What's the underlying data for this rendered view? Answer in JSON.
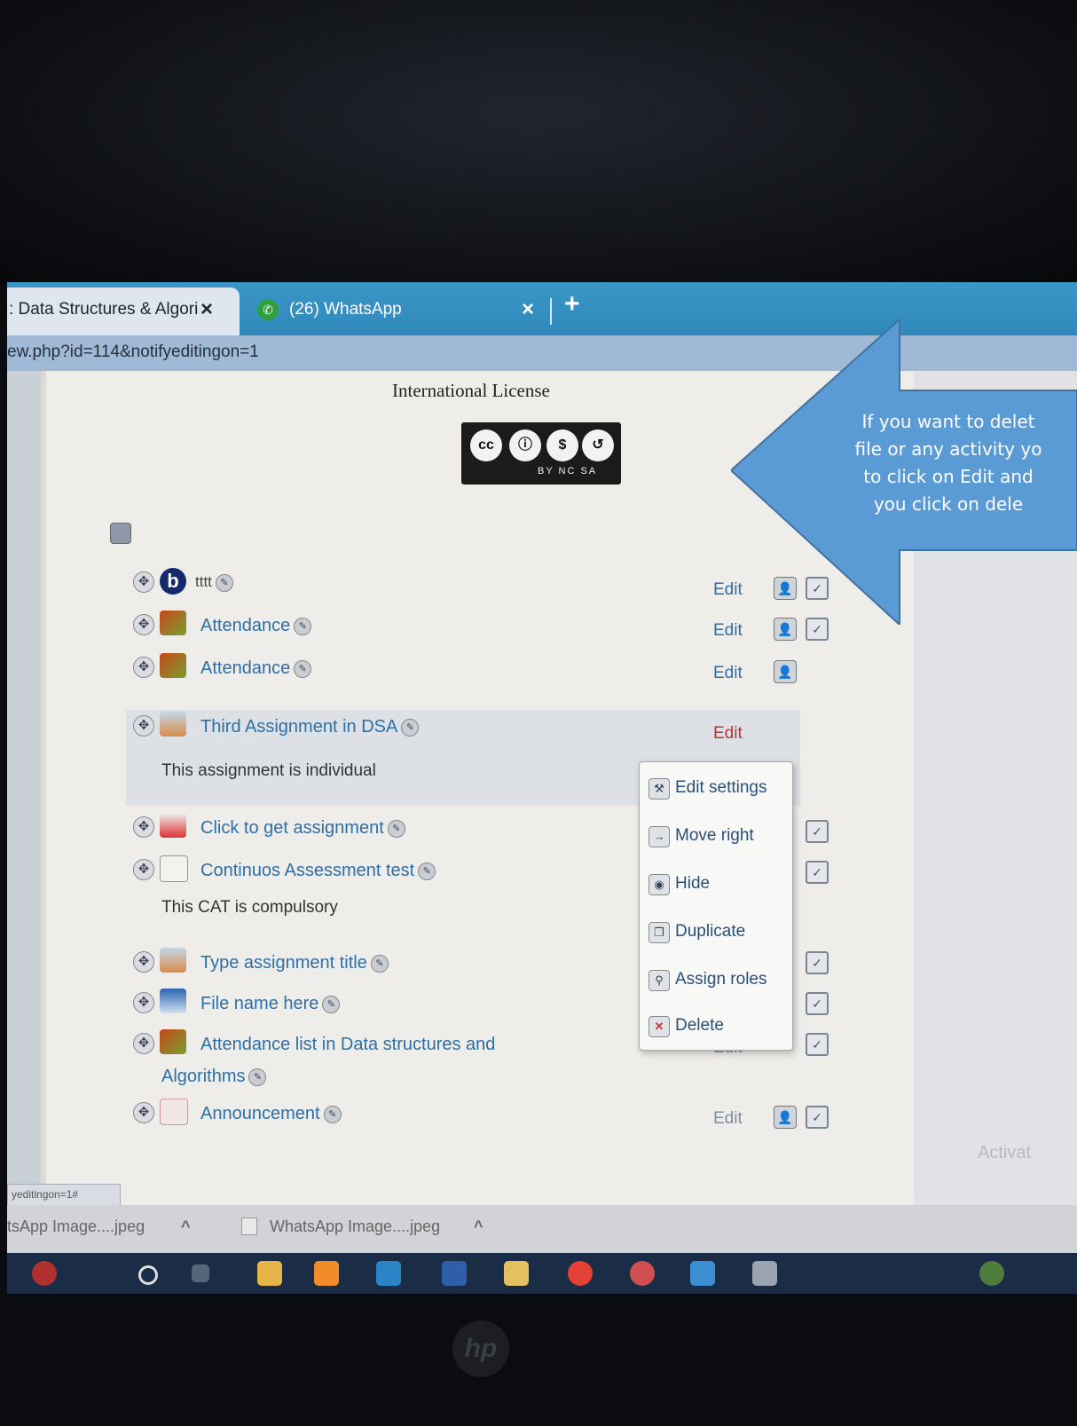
{
  "browser": {
    "tabs": [
      {
        "label": ": Data Structures & Algori",
        "close": "×"
      },
      {
        "label": "(26) WhatsApp",
        "close": "×"
      }
    ],
    "new_tab": "+",
    "address": "ew.php?id=114&notifyeditingon=1"
  },
  "page": {
    "license_text": "International License",
    "cc_badge": {
      "label": "BY NC SA"
    },
    "activities": [
      {
        "label": "tttt",
        "icon": "bigbluebutton-icon",
        "edit": "Edit"
      },
      {
        "label": "Attendance",
        "icon": "attendance-icon",
        "edit": "Edit"
      },
      {
        "label": "Attendance",
        "icon": "attendance-icon",
        "edit": "Edit"
      },
      {
        "label": "Third Assignment in DSA",
        "icon": "assignment-icon",
        "edit": "Edit",
        "desc": "This assignment is individual"
      },
      {
        "label": "Click to get assignment",
        "icon": "pdf-file-icon"
      },
      {
        "label": "Continuos Assessment test",
        "icon": "quiz-icon",
        "desc": "This CAT is compulsory"
      },
      {
        "label": "Type assignment title",
        "icon": "assignment-icon"
      },
      {
        "label": "File name here",
        "icon": "word-file-icon"
      },
      {
        "label": "Attendance list in Data structures and",
        "label2": "Algorithms",
        "icon": "attendance-icon",
        "edit": "Edit"
      },
      {
        "label": "Announcement",
        "icon": "forum-icon",
        "edit": "Edit"
      }
    ],
    "edit_menu": [
      {
        "label": "Edit settings",
        "icon": "wrench-icon"
      },
      {
        "label": "Move right",
        "icon": "arrow-right-icon"
      },
      {
        "label": "Hide",
        "icon": "eye-icon"
      },
      {
        "label": "Duplicate",
        "icon": "duplicate-icon"
      },
      {
        "label": "Assign roles",
        "icon": "assign-roles-icon"
      },
      {
        "label": "Delete",
        "icon": "delete-icon"
      }
    ],
    "status_url": "yeditingon=1#",
    "watermark": "Activat"
  },
  "downloads": [
    {
      "label": "tsApp Image....jpeg",
      "caret": "^"
    },
    {
      "label": "WhatsApp Image....jpeg",
      "caret": "^"
    }
  ],
  "callout": {
    "lines": [
      "If you want to delet",
      "file or any activity yo",
      "to click on Edit and",
      "you click on dele"
    ],
    "color": "#5b9bd5"
  },
  "hardware": {
    "logo": "hp"
  }
}
